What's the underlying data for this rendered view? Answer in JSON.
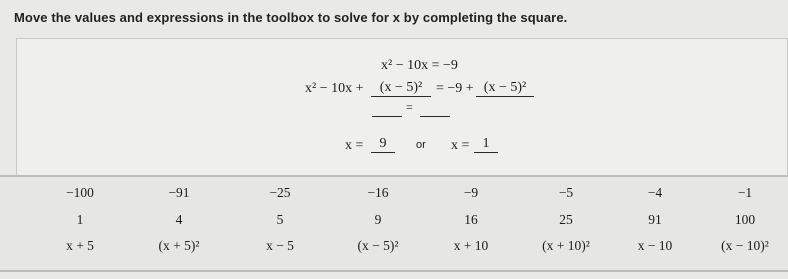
{
  "instruction": "Move the values and expressions in the toolbox to solve for x by completing the square.",
  "work": {
    "line1": "x² − 10x = −9",
    "line2_left": "x² − 10x + ",
    "slot_a": "(x − 5)²",
    "line2_mid": "= −9 + ",
    "slot_b": "(x − 5)²",
    "line3_eq": "=",
    "slot_c": "",
    "slot_d": "",
    "x_label_1": "x =",
    "slot_e": "9",
    "or": "or",
    "x_label_2": "x =",
    "slot_f": "1"
  },
  "toolbox": {
    "row1": [
      "−100",
      "−91",
      "−25",
      "−16",
      "−9",
      "−5",
      "−4",
      "−1"
    ],
    "row2": [
      "1",
      "4",
      "5",
      "9",
      "16",
      "25",
      "91",
      "100"
    ],
    "row3": [
      "x + 5",
      "(x + 5)²",
      "x − 5",
      "(x − 5)²",
      "x + 10",
      "(x + 10)²",
      "x − 10",
      "(x − 10)²"
    ]
  }
}
